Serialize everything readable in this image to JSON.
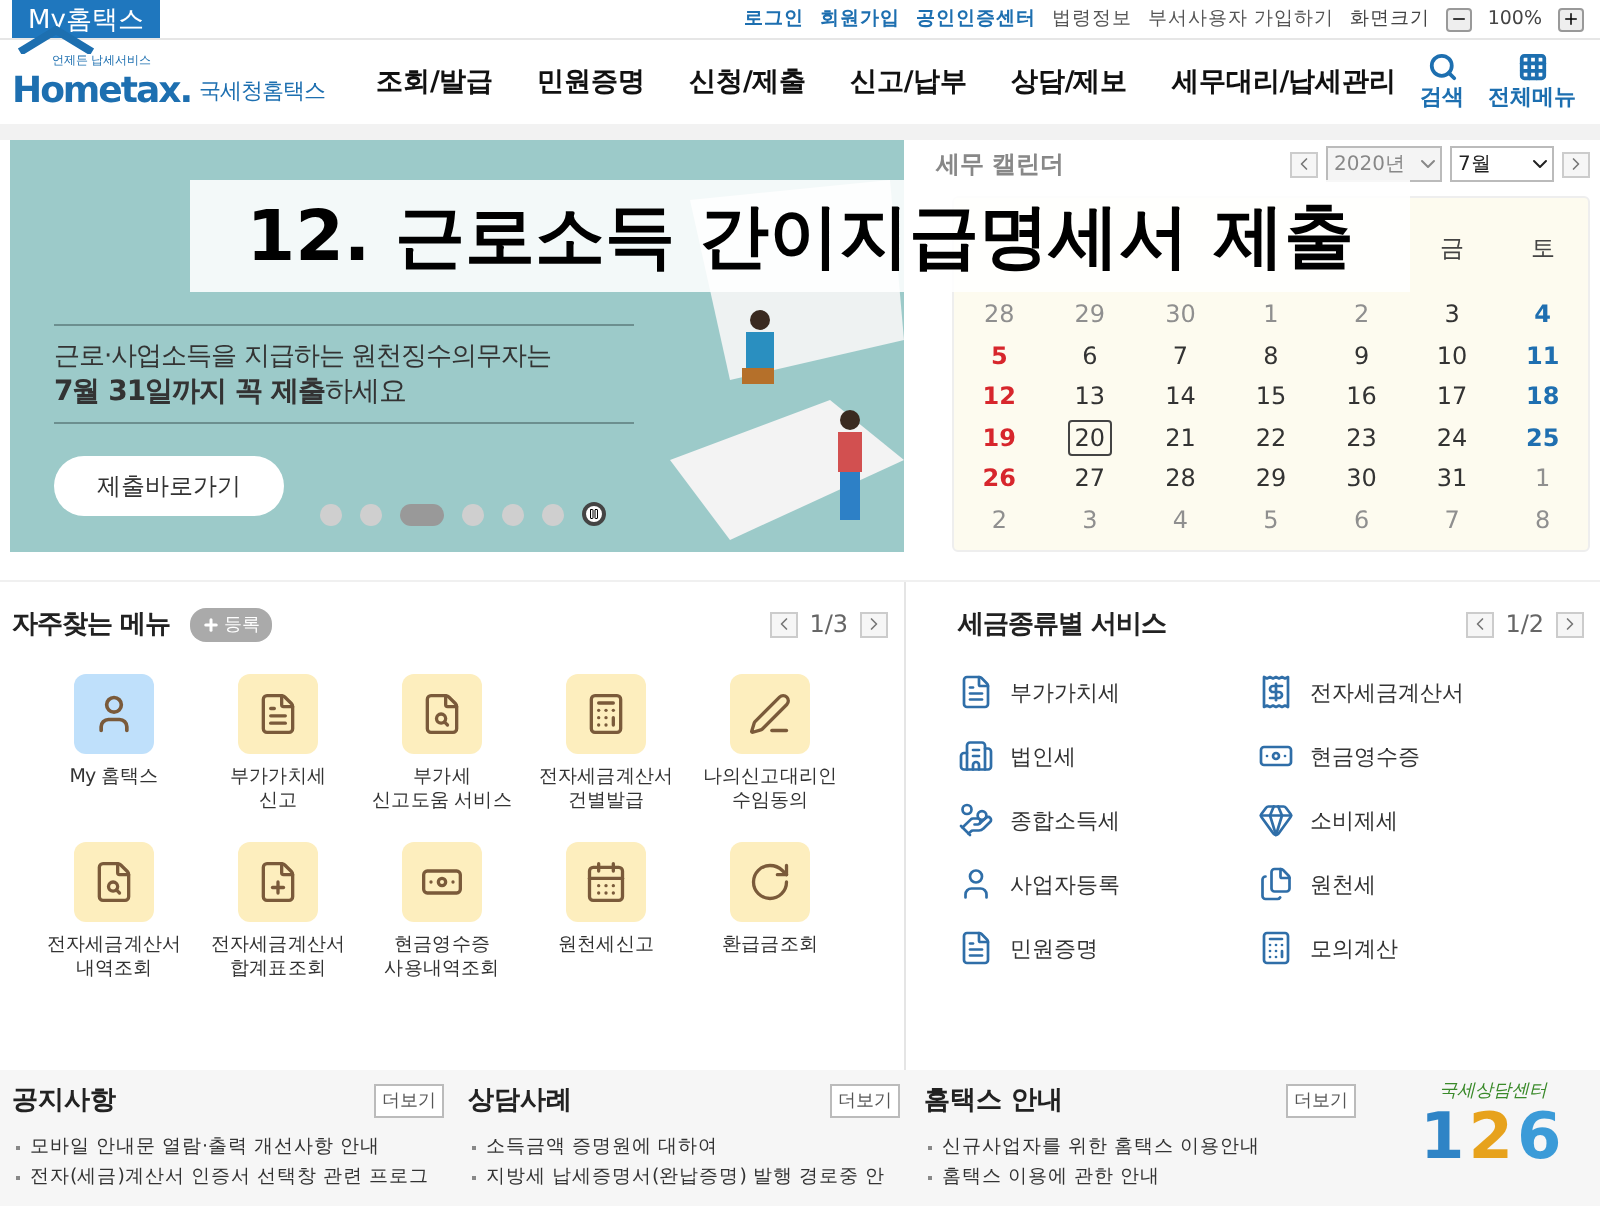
{
  "top_bar": {
    "my_tab": "My홈택스",
    "links": [
      {
        "label": "로그인",
        "kind": "primary"
      },
      {
        "label": "회원가입",
        "kind": "primary"
      },
      {
        "label": "공인인증센터",
        "kind": "primary"
      },
      {
        "label": "법령정보",
        "kind": "plain"
      },
      {
        "label": "부서사용자 가입하기",
        "kind": "plain"
      }
    ],
    "zoom_label": "화면크기",
    "zoom_value": "100%"
  },
  "header": {
    "logo_tagline": "언제든 납세서비스",
    "logo_text": "Hometax.",
    "logo_name": "국세청홈택스",
    "nav": [
      "조회/발급",
      "민원증명",
      "신청/제출",
      "신고/납부",
      "상담/제보",
      "세무대리/납세관리"
    ],
    "search": "검색",
    "all_menu": "전체메뉴"
  },
  "overlay_title": "12. 근로소득 간이지급명세서 제출",
  "banner": {
    "subtitle": "근로·사업소득을 지급하는 원천징수의무자는",
    "highlight": "**7월 31일까지 꼭 제출**하세요",
    "button": "제출바로가기",
    "slides": [
      {
        "selected": false
      },
      {
        "selected": false
      },
      {
        "selected": true
      },
      {
        "selected": false
      },
      {
        "selected": false
      },
      {
        "selected": false
      }
    ]
  },
  "calendar": {
    "title": "세무 캘린더",
    "year": {
      "value": "2020년",
      "disabled": true
    },
    "month": {
      "value": "7월",
      "disabled": false
    },
    "weekdays": [
      "금",
      "토"
    ],
    "weeks": [
      [
        {
          "text": "28",
          "kind": "muted"
        },
        {
          "text": "29",
          "kind": "muted"
        },
        {
          "text": "30",
          "kind": "muted"
        },
        {
          "text": "1",
          "kind": "muted"
        },
        {
          "text": "2",
          "kind": "muted"
        },
        {
          "text": "3",
          "kind": "day"
        },
        {
          "text": "4",
          "kind": "sat"
        }
      ],
      [
        {
          "text": "5",
          "kind": "sun"
        },
        {
          "text": "6",
          "kind": "day"
        },
        {
          "text": "7",
          "kind": "day"
        },
        {
          "text": "8",
          "kind": "day"
        },
        {
          "text": "9",
          "kind": "day"
        },
        {
          "text": "10",
          "kind": "day"
        },
        {
          "text": "11",
          "kind": "sat"
        }
      ],
      [
        {
          "text": "12",
          "kind": "sun"
        },
        {
          "text": "13",
          "kind": "day"
        },
        {
          "text": "14",
          "kind": "day"
        },
        {
          "text": "15",
          "kind": "day"
        },
        {
          "text": "16",
          "kind": "day"
        },
        {
          "text": "17",
          "kind": "day"
        },
        {
          "text": "18",
          "kind": "sat"
        }
      ],
      [
        {
          "text": "19",
          "kind": "sun"
        },
        {
          "text": "20",
          "kind": "today"
        },
        {
          "text": "21",
          "kind": "day"
        },
        {
          "text": "22",
          "kind": "day"
        },
        {
          "text": "23",
          "kind": "day"
        },
        {
          "text": "24",
          "kind": "day"
        },
        {
          "text": "25",
          "kind": "sat"
        }
      ],
      [
        {
          "text": "26",
          "kind": "sun"
        },
        {
          "text": "27",
          "kind": "day"
        },
        {
          "text": "28",
          "kind": "day"
        },
        {
          "text": "29",
          "kind": "day"
        },
        {
          "text": "30",
          "kind": "day"
        },
        {
          "text": "31",
          "kind": "day"
        },
        {
          "text": "1",
          "kind": "muted"
        }
      ],
      [
        {
          "text": "2",
          "kind": "muted"
        },
        {
          "text": "3",
          "kind": "muted"
        },
        {
          "text": "4",
          "kind": "muted"
        },
        {
          "text": "5",
          "kind": "muted"
        },
        {
          "text": "6",
          "kind": "muted"
        },
        {
          "text": "7",
          "kind": "muted"
        },
        {
          "text": "8",
          "kind": "muted"
        }
      ]
    ]
  },
  "favorites": {
    "title": "자주찾는 메뉴",
    "add_button": "등록",
    "page": "1/3",
    "items": [
      {
        "label": "My 홈택스",
        "kind": "user"
      },
      {
        "label": "부가가치세\n신고",
        "kind": "vat"
      },
      {
        "label": "부가세\n신고도움 서비스",
        "kind": "search"
      },
      {
        "label": "전자세금계산서\n건별발급",
        "kind": "calc"
      },
      {
        "label": "나의신고대리인\n수임동의",
        "kind": "pen"
      },
      {
        "label": "전자세금계산서\n내역조회",
        "kind": "search"
      },
      {
        "label": "전자세금계산서\n합계표조회",
        "kind": "plus"
      },
      {
        "label": "현금영수증\n사용내역조회",
        "kind": "cash"
      },
      {
        "label": "원천세신고",
        "kind": "calendar"
      },
      {
        "label": "환급금조회",
        "kind": "refund"
      }
    ]
  },
  "tax_services": {
    "title": "세금종류별 서비스",
    "page": "1/2",
    "items": [
      {
        "label": "부가가치세",
        "kind": "vat"
      },
      {
        "label": "전자세금계산서",
        "kind": "invoice"
      },
      {
        "label": "법인세",
        "kind": "building"
      },
      {
        "label": "현금영수증",
        "kind": "cash"
      },
      {
        "label": "종합소득세",
        "kind": "money"
      },
      {
        "label": "소비제세",
        "kind": "gem"
      },
      {
        "label": "사업자등록",
        "kind": "user"
      },
      {
        "label": "원천세",
        "kind": "files"
      },
      {
        "label": "민원증명",
        "kind": "doc"
      },
      {
        "label": "모의계산",
        "kind": "calc"
      }
    ]
  },
  "boards": [
    {
      "title": "공지사항",
      "more": "더보기",
      "items": [
        "모바일 안내문 열람·출력 개선사항 안내",
        "전자(세금)계산서 인증서 선택창 관련 프로그"
      ]
    },
    {
      "title": "상담사례",
      "more": "더보기",
      "items": [
        "소득금액 증명원에 대하여",
        "지방세 납세증명서(완납증명) 발행 경로중 안"
      ]
    },
    {
      "title": "홈택스 안내",
      "more": "더보기",
      "items": [
        "신규사업자를 위한 홈택스 이용안내",
        "홈택스 이용에 관한 안내"
      ]
    }
  ],
  "center_logo": {
    "caption": "국세상담센터",
    "number": "126"
  }
}
